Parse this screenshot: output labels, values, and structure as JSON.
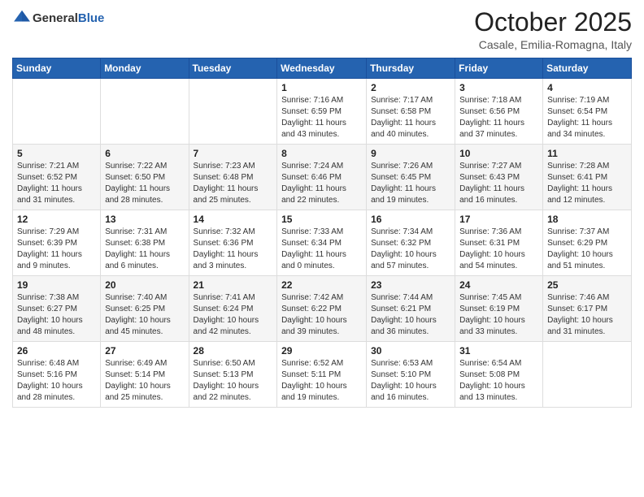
{
  "header": {
    "logo_general": "General",
    "logo_blue": "Blue",
    "title": "October 2025",
    "location": "Casale, Emilia-Romagna, Italy"
  },
  "days_of_week": [
    "Sunday",
    "Monday",
    "Tuesday",
    "Wednesday",
    "Thursday",
    "Friday",
    "Saturday"
  ],
  "weeks": [
    {
      "days": [
        {
          "num": "",
          "info": ""
        },
        {
          "num": "",
          "info": ""
        },
        {
          "num": "",
          "info": ""
        },
        {
          "num": "1",
          "info": "Sunrise: 7:16 AM\nSunset: 6:59 PM\nDaylight: 11 hours and 43 minutes."
        },
        {
          "num": "2",
          "info": "Sunrise: 7:17 AM\nSunset: 6:58 PM\nDaylight: 11 hours and 40 minutes."
        },
        {
          "num": "3",
          "info": "Sunrise: 7:18 AM\nSunset: 6:56 PM\nDaylight: 11 hours and 37 minutes."
        },
        {
          "num": "4",
          "info": "Sunrise: 7:19 AM\nSunset: 6:54 PM\nDaylight: 11 hours and 34 minutes."
        }
      ]
    },
    {
      "days": [
        {
          "num": "5",
          "info": "Sunrise: 7:21 AM\nSunset: 6:52 PM\nDaylight: 11 hours and 31 minutes."
        },
        {
          "num": "6",
          "info": "Sunrise: 7:22 AM\nSunset: 6:50 PM\nDaylight: 11 hours and 28 minutes."
        },
        {
          "num": "7",
          "info": "Sunrise: 7:23 AM\nSunset: 6:48 PM\nDaylight: 11 hours and 25 minutes."
        },
        {
          "num": "8",
          "info": "Sunrise: 7:24 AM\nSunset: 6:46 PM\nDaylight: 11 hours and 22 minutes."
        },
        {
          "num": "9",
          "info": "Sunrise: 7:26 AM\nSunset: 6:45 PM\nDaylight: 11 hours and 19 minutes."
        },
        {
          "num": "10",
          "info": "Sunrise: 7:27 AM\nSunset: 6:43 PM\nDaylight: 11 hours and 16 minutes."
        },
        {
          "num": "11",
          "info": "Sunrise: 7:28 AM\nSunset: 6:41 PM\nDaylight: 11 hours and 12 minutes."
        }
      ]
    },
    {
      "days": [
        {
          "num": "12",
          "info": "Sunrise: 7:29 AM\nSunset: 6:39 PM\nDaylight: 11 hours and 9 minutes."
        },
        {
          "num": "13",
          "info": "Sunrise: 7:31 AM\nSunset: 6:38 PM\nDaylight: 11 hours and 6 minutes."
        },
        {
          "num": "14",
          "info": "Sunrise: 7:32 AM\nSunset: 6:36 PM\nDaylight: 11 hours and 3 minutes."
        },
        {
          "num": "15",
          "info": "Sunrise: 7:33 AM\nSunset: 6:34 PM\nDaylight: 11 hours and 0 minutes."
        },
        {
          "num": "16",
          "info": "Sunrise: 7:34 AM\nSunset: 6:32 PM\nDaylight: 10 hours and 57 minutes."
        },
        {
          "num": "17",
          "info": "Sunrise: 7:36 AM\nSunset: 6:31 PM\nDaylight: 10 hours and 54 minutes."
        },
        {
          "num": "18",
          "info": "Sunrise: 7:37 AM\nSunset: 6:29 PM\nDaylight: 10 hours and 51 minutes."
        }
      ]
    },
    {
      "days": [
        {
          "num": "19",
          "info": "Sunrise: 7:38 AM\nSunset: 6:27 PM\nDaylight: 10 hours and 48 minutes."
        },
        {
          "num": "20",
          "info": "Sunrise: 7:40 AM\nSunset: 6:25 PM\nDaylight: 10 hours and 45 minutes."
        },
        {
          "num": "21",
          "info": "Sunrise: 7:41 AM\nSunset: 6:24 PM\nDaylight: 10 hours and 42 minutes."
        },
        {
          "num": "22",
          "info": "Sunrise: 7:42 AM\nSunset: 6:22 PM\nDaylight: 10 hours and 39 minutes."
        },
        {
          "num": "23",
          "info": "Sunrise: 7:44 AM\nSunset: 6:21 PM\nDaylight: 10 hours and 36 minutes."
        },
        {
          "num": "24",
          "info": "Sunrise: 7:45 AM\nSunset: 6:19 PM\nDaylight: 10 hours and 33 minutes."
        },
        {
          "num": "25",
          "info": "Sunrise: 7:46 AM\nSunset: 6:17 PM\nDaylight: 10 hours and 31 minutes."
        }
      ]
    },
    {
      "days": [
        {
          "num": "26",
          "info": "Sunrise: 6:48 AM\nSunset: 5:16 PM\nDaylight: 10 hours and 28 minutes."
        },
        {
          "num": "27",
          "info": "Sunrise: 6:49 AM\nSunset: 5:14 PM\nDaylight: 10 hours and 25 minutes."
        },
        {
          "num": "28",
          "info": "Sunrise: 6:50 AM\nSunset: 5:13 PM\nDaylight: 10 hours and 22 minutes."
        },
        {
          "num": "29",
          "info": "Sunrise: 6:52 AM\nSunset: 5:11 PM\nDaylight: 10 hours and 19 minutes."
        },
        {
          "num": "30",
          "info": "Sunrise: 6:53 AM\nSunset: 5:10 PM\nDaylight: 10 hours and 16 minutes."
        },
        {
          "num": "31",
          "info": "Sunrise: 6:54 AM\nSunset: 5:08 PM\nDaylight: 10 hours and 13 minutes."
        },
        {
          "num": "",
          "info": ""
        }
      ]
    }
  ]
}
